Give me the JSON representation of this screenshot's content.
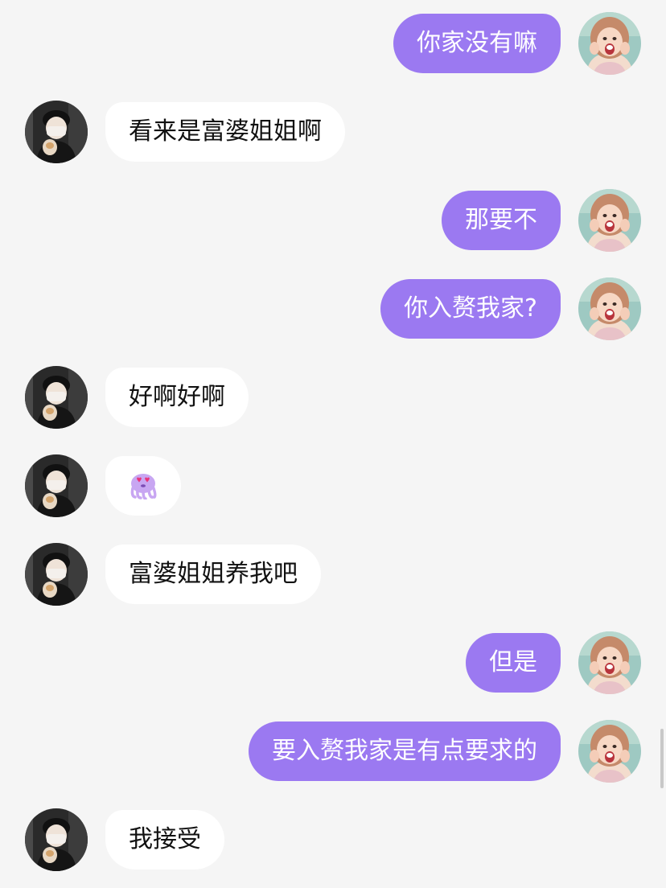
{
  "colors": {
    "background": "#f5f5f5",
    "outgoing_bubble": "#9b79f1",
    "incoming_bubble": "#ffffff",
    "incoming_text": "#111111"
  },
  "messages": [
    {
      "direction": "outgoing",
      "text": "你家没有嘛"
    },
    {
      "direction": "incoming",
      "text": "看来是富婆姐姐啊"
    },
    {
      "direction": "outgoing",
      "text": "那要不"
    },
    {
      "direction": "outgoing",
      "text": "你入赘我家?"
    },
    {
      "direction": "incoming",
      "text": "好啊好啊"
    },
    {
      "direction": "incoming",
      "sticker": "heart-eyes-octopus-emoji"
    },
    {
      "direction": "incoming",
      "text": "富婆姐姐养我吧"
    },
    {
      "direction": "outgoing",
      "text": "但是"
    },
    {
      "direction": "outgoing",
      "text": "要入赘我家是有点要求的"
    },
    {
      "direction": "incoming",
      "text": "我接受"
    }
  ]
}
